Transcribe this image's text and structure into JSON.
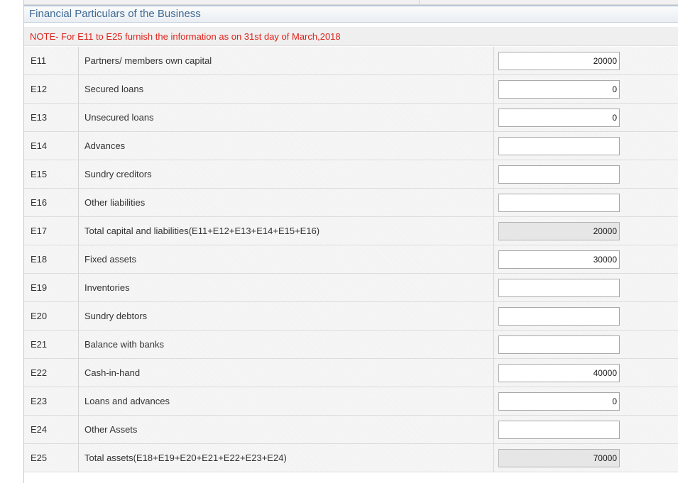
{
  "section": {
    "title": "Financial Particulars of the Business",
    "note": "NOTE- For E11 to E25 furnish the information as on 31st day of March,2018"
  },
  "rows": [
    {
      "code": "E11",
      "label": "Partners/ members own capital",
      "value": "20000",
      "readonly": false
    },
    {
      "code": "E12",
      "label": "Secured loans",
      "value": "0",
      "readonly": false
    },
    {
      "code": "E13",
      "label": "Unsecured loans",
      "value": "0",
      "readonly": false
    },
    {
      "code": "E14",
      "label": "Advances",
      "value": "",
      "readonly": false
    },
    {
      "code": "E15",
      "label": "Sundry creditors",
      "value": "",
      "readonly": false
    },
    {
      "code": "E16",
      "label": "Other liabilities",
      "value": "",
      "readonly": false
    },
    {
      "code": "E17",
      "label": "Total capital and liabilities(E11+E12+E13+E14+E15+E16)",
      "value": "20000",
      "readonly": true
    },
    {
      "code": "E18",
      "label": "Fixed assets",
      "value": "30000",
      "readonly": false
    },
    {
      "code": "E19",
      "label": "Inventories",
      "value": "",
      "readonly": false
    },
    {
      "code": "E20",
      "label": "Sundry debtors",
      "value": "",
      "readonly": false
    },
    {
      "code": "E21",
      "label": "Balance with banks",
      "value": "",
      "readonly": false
    },
    {
      "code": "E22",
      "label": "Cash-in-hand",
      "value": "40000",
      "readonly": false
    },
    {
      "code": "E23",
      "label": "Loans and advances",
      "value": "0",
      "readonly": false
    },
    {
      "code": "E24",
      "label": "Other Assets",
      "value": "",
      "readonly": false
    },
    {
      "code": "E25",
      "label": "Total assets(E18+E19+E20+E21+E22+E23+E24)",
      "value": "70000",
      "readonly": true
    }
  ]
}
